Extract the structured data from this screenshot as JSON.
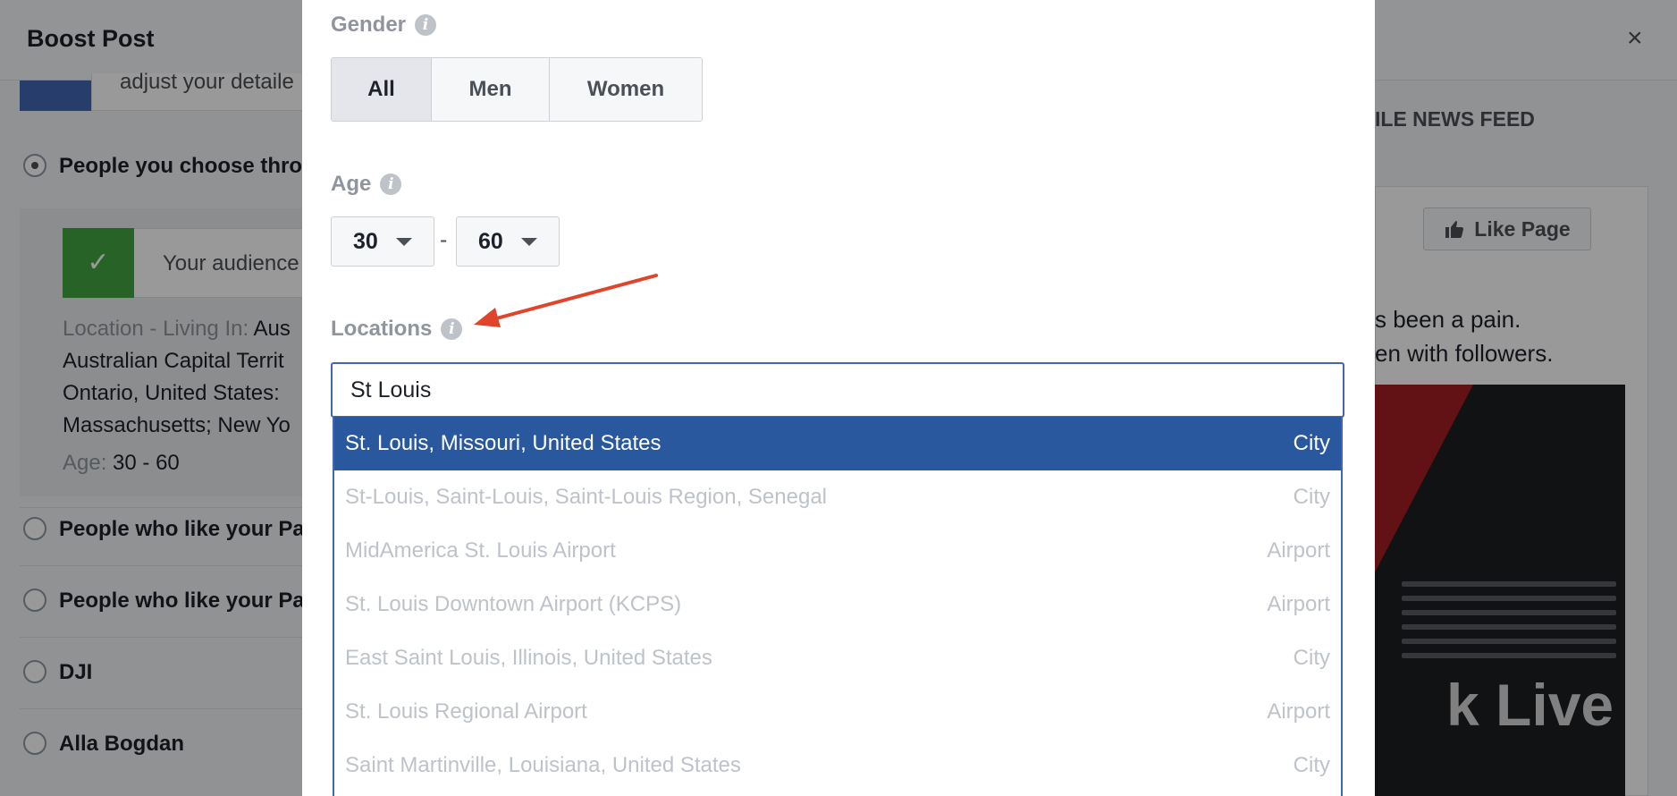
{
  "background": {
    "title": "Boost Post",
    "close_symbol": "×",
    "adjust_text": "adjust your detaile",
    "options": [
      {
        "label": "People you choose thro",
        "selected": true
      },
      {
        "label": "People who like your Pa",
        "selected": false
      },
      {
        "label": "People who like your Pa",
        "selected": false
      },
      {
        "label": "DJI",
        "selected": false
      },
      {
        "label": "Alla Bogdan",
        "selected": false
      }
    ],
    "audience_text": "Your audience",
    "location_label": "Location - Living In:",
    "location_lines": [
      "Aus",
      "Australian Capital Territ",
      "Ontario, United States: ",
      "Massachusetts; New Yo"
    ],
    "age_label": "Age:",
    "age_value": "30 - 60",
    "preview_tab": "ILE NEWS FEED",
    "like_page_label": "Like Page",
    "post_text_lines": [
      "s been a pain.",
      "en with followers."
    ],
    "video_text": "k Live"
  },
  "modal": {
    "gender_label": "Gender",
    "gender_options": [
      "All",
      "Men",
      "Women"
    ],
    "gender_selected": "All",
    "age_label": "Age",
    "age_min": "30",
    "age_dash": "-",
    "age_max": "60",
    "locations_label": "Locations",
    "location_input_value": "St Louis",
    "suggestions": [
      {
        "name": "St. Louis, Missouri, United States",
        "type": "City",
        "highlighted": true
      },
      {
        "name": "St-Louis, Saint-Louis, Saint-Louis Region, Senegal",
        "type": "City",
        "highlighted": false
      },
      {
        "name": "MidAmerica St. Louis Airport",
        "type": "Airport",
        "highlighted": false
      },
      {
        "name": "St. Louis Downtown Airport (KCPS)",
        "type": "Airport",
        "highlighted": false
      },
      {
        "name": "East Saint Louis, Illinois, United States",
        "type": "City",
        "highlighted": false
      },
      {
        "name": "St. Louis Regional Airport",
        "type": "Airport",
        "highlighted": false
      },
      {
        "name": "Saint Martinville, Louisiana, United States",
        "type": "City",
        "highlighted": false
      }
    ]
  },
  "colors": {
    "accent_blue": "#4267b2",
    "selected_row": "#29589f",
    "annotation_arrow": "#e0452b",
    "check_green": "#42a442"
  }
}
